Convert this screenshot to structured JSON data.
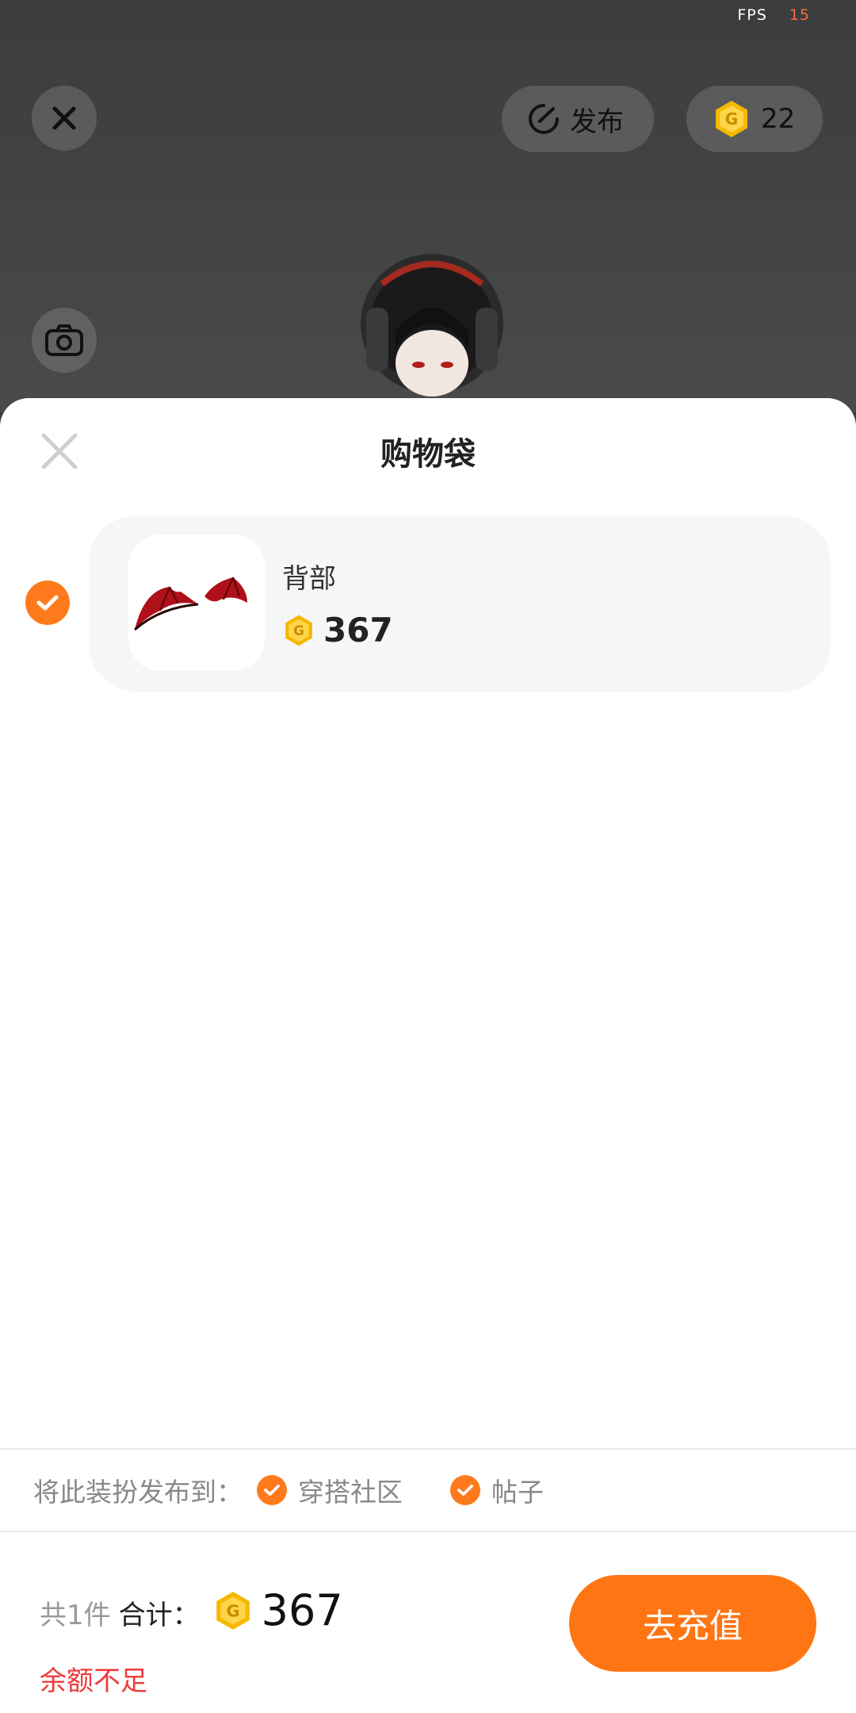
{
  "status": {
    "fps_label": "FPS",
    "fps_value": "15"
  },
  "scene": {
    "publish_label": "发布",
    "coin_balance": "22"
  },
  "sheet": {
    "title": "购物袋",
    "items": [
      {
        "name": "背部",
        "price": "367",
        "selected": true
      }
    ],
    "publish_to_label": "将此装扮发布到：",
    "publish_options": [
      {
        "label": "穿搭社区",
        "checked": true
      },
      {
        "label": "帖子",
        "checked": true
      }
    ],
    "footer": {
      "count_text": "共1件",
      "total_label": "合计：",
      "total_value": "367",
      "warning": "余额不足",
      "recharge_label": "去充值"
    }
  },
  "colors": {
    "accent": "#ff7513",
    "coin": "#f5b800",
    "warning": "#ee3b3b"
  }
}
